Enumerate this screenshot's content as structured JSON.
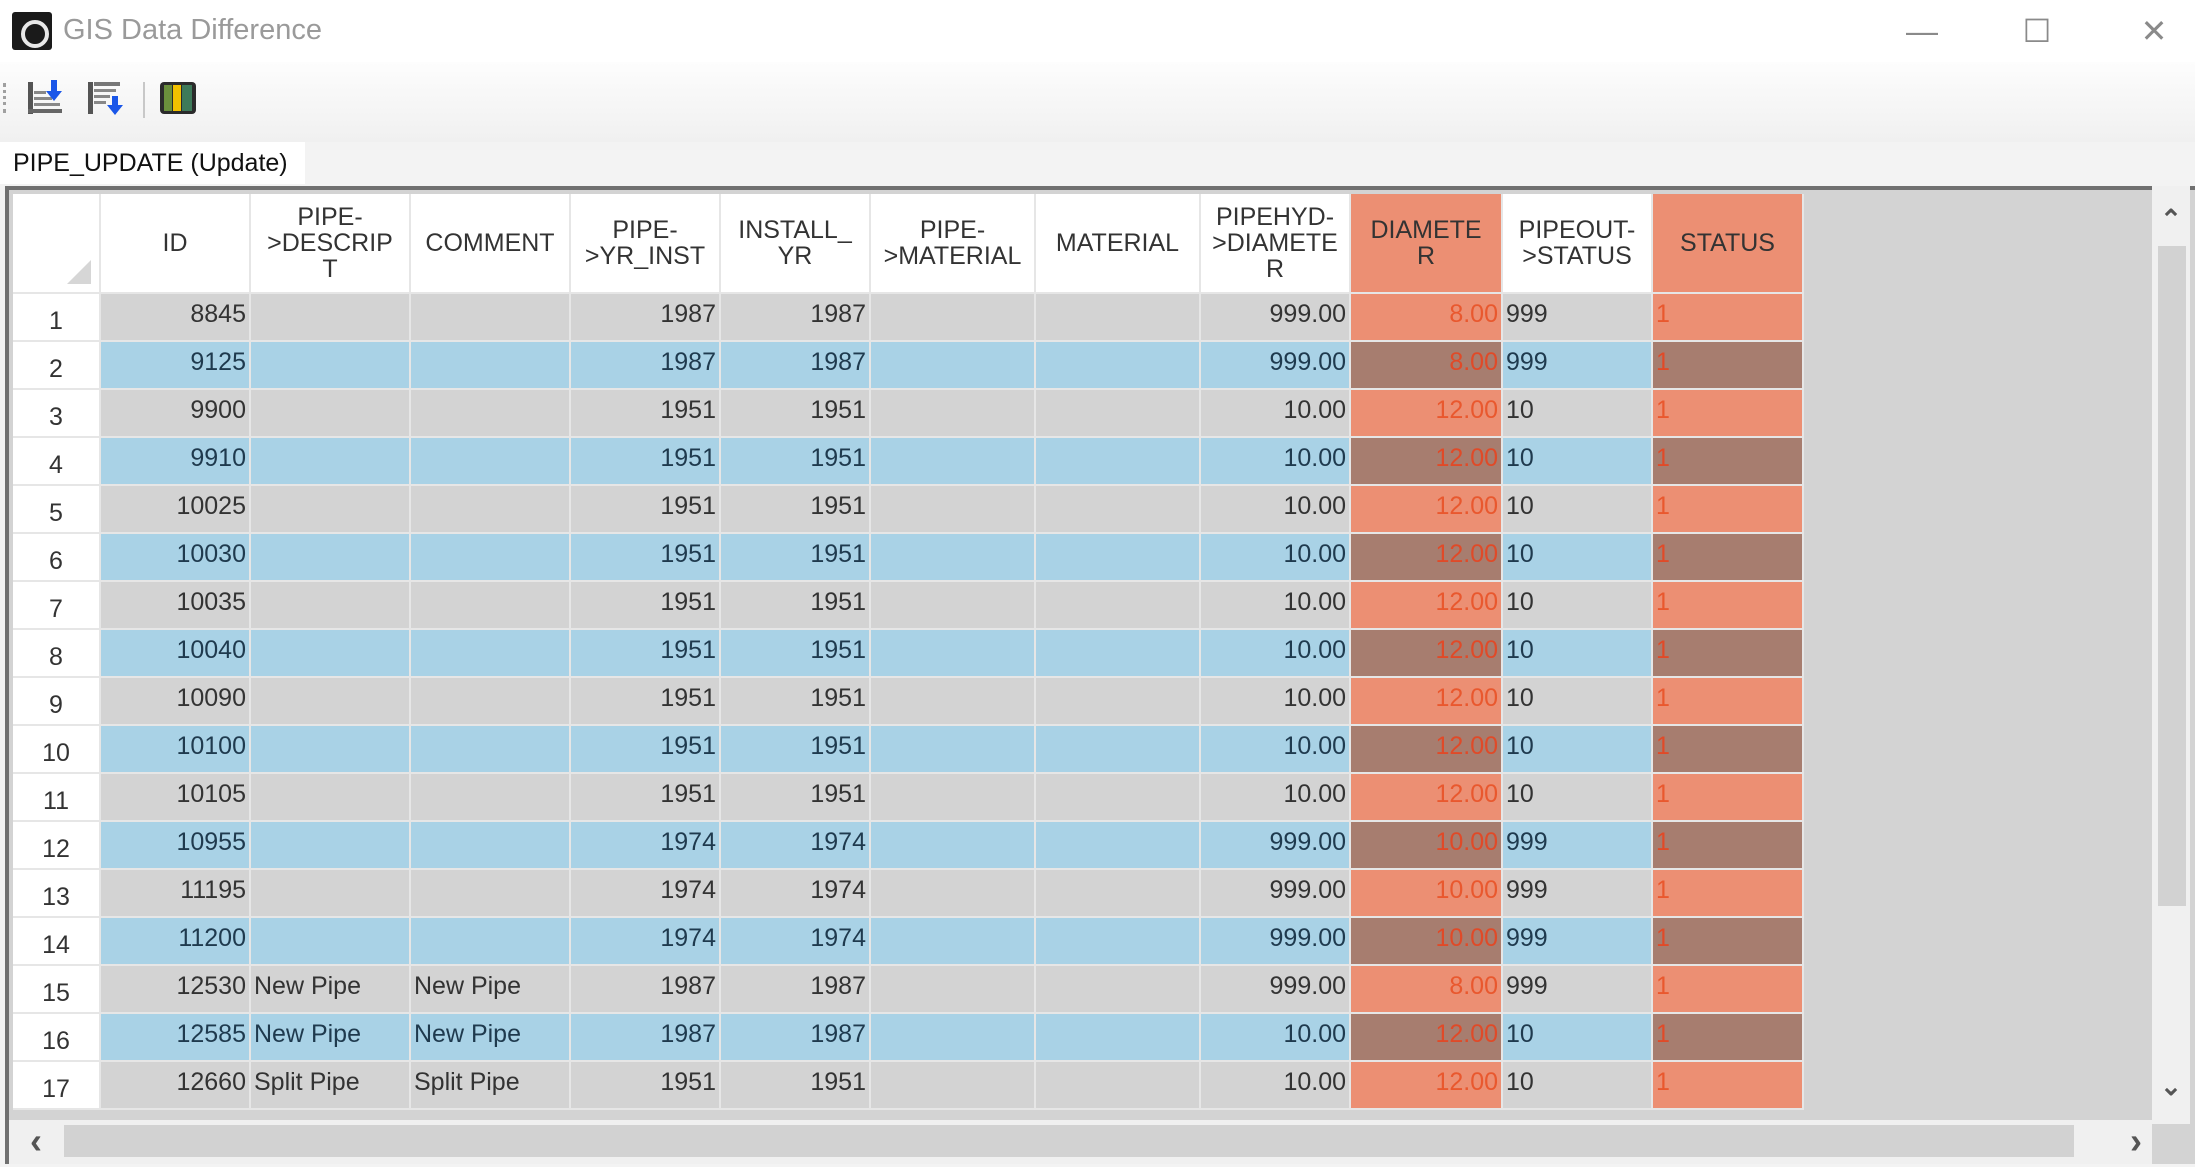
{
  "window": {
    "title": "GIS Data Difference",
    "minimize_icon": "minimize-icon",
    "maximize_icon": "maximize-icon",
    "close_icon": "close-icon",
    "minimize_glyph": "—",
    "maximize_glyph": "☐",
    "close_glyph": "✕"
  },
  "toolbar": {
    "buttons": [
      {
        "name": "export-down-icon"
      },
      {
        "name": "filter-down-icon"
      },
      {
        "name": "columns-color-icon"
      }
    ]
  },
  "tab": {
    "label": "PIPE_UPDATE (Update)"
  },
  "colors": {
    "diff_bg": "#ec8f73",
    "diff_bg_selected": "#a77d6f",
    "diff_text": "#e9582e",
    "row_alt_bg": "#a9d2e6"
  },
  "grid": {
    "columns": [
      {
        "key": "id",
        "label": "ID",
        "align": "num",
        "diff": false
      },
      {
        "key": "descrip",
        "label": "PIPE->DESCRIPT",
        "align": "left",
        "diff": false
      },
      {
        "key": "comment",
        "label": "COMMENT",
        "align": "left",
        "diff": false
      },
      {
        "key": "yr_inst",
        "label": "PIPE->YR_INST",
        "align": "num",
        "diff": false
      },
      {
        "key": "install_yr",
        "label": "INSTALL_YR",
        "align": "num",
        "diff": false
      },
      {
        "key": "pipe_material",
        "label": "PIPE->MATERIAL",
        "align": "left",
        "diff": false
      },
      {
        "key": "material",
        "label": "MATERIAL",
        "align": "left",
        "diff": false
      },
      {
        "key": "pipehyd_diameter",
        "label": "PIPEHYD->DIAMETER",
        "align": "num",
        "diff": false
      },
      {
        "key": "diameter",
        "label": "DIAMETER",
        "align": "num",
        "diff": true
      },
      {
        "key": "pipeout_status",
        "label": "PIPEOUT->STATUS",
        "align": "left",
        "diff": false
      },
      {
        "key": "status",
        "label": "STATUS",
        "align": "left",
        "diff": true
      }
    ],
    "header_lines": {
      "id": [
        "ID"
      ],
      "descrip": [
        "PIPE-",
        ">DESCRIP",
        "T"
      ],
      "comment": [
        "COMMENT"
      ],
      "yr_inst": [
        "PIPE-",
        ">YR_INST"
      ],
      "install_yr": [
        "INSTALL_",
        "YR"
      ],
      "pipe_material": [
        "PIPE-",
        ">MATERIAL"
      ],
      "material": [
        "MATERIAL"
      ],
      "pipehyd_diameter": [
        "PIPEHYD-",
        ">DIAMETE",
        "R"
      ],
      "diameter": [
        "DIAMETE",
        "R"
      ],
      "pipeout_status": [
        "PIPEOUT-",
        ">STATUS"
      ],
      "status": [
        "STATUS"
      ]
    },
    "rows": [
      {
        "n": "1",
        "id": "8845",
        "descrip": "",
        "comment": "",
        "yr_inst": "1987",
        "install_yr": "1987",
        "pipe_material": "",
        "material": "",
        "pipehyd_diameter": "999.00",
        "diameter": "8.00",
        "pipeout_status": "999",
        "status": "1"
      },
      {
        "n": "2",
        "id": "9125",
        "descrip": "",
        "comment": "",
        "yr_inst": "1987",
        "install_yr": "1987",
        "pipe_material": "",
        "material": "",
        "pipehyd_diameter": "999.00",
        "diameter": "8.00",
        "pipeout_status": "999",
        "status": "1"
      },
      {
        "n": "3",
        "id": "9900",
        "descrip": "",
        "comment": "",
        "yr_inst": "1951",
        "install_yr": "1951",
        "pipe_material": "",
        "material": "",
        "pipehyd_diameter": "10.00",
        "diameter": "12.00",
        "pipeout_status": "10",
        "status": "1"
      },
      {
        "n": "4",
        "id": "9910",
        "descrip": "",
        "comment": "",
        "yr_inst": "1951",
        "install_yr": "1951",
        "pipe_material": "",
        "material": "",
        "pipehyd_diameter": "10.00",
        "diameter": "12.00",
        "pipeout_status": "10",
        "status": "1"
      },
      {
        "n": "5",
        "id": "10025",
        "descrip": "",
        "comment": "",
        "yr_inst": "1951",
        "install_yr": "1951",
        "pipe_material": "",
        "material": "",
        "pipehyd_diameter": "10.00",
        "diameter": "12.00",
        "pipeout_status": "10",
        "status": "1"
      },
      {
        "n": "6",
        "id": "10030",
        "descrip": "",
        "comment": "",
        "yr_inst": "1951",
        "install_yr": "1951",
        "pipe_material": "",
        "material": "",
        "pipehyd_diameter": "10.00",
        "diameter": "12.00",
        "pipeout_status": "10",
        "status": "1"
      },
      {
        "n": "7",
        "id": "10035",
        "descrip": "",
        "comment": "",
        "yr_inst": "1951",
        "install_yr": "1951",
        "pipe_material": "",
        "material": "",
        "pipehyd_diameter": "10.00",
        "diameter": "12.00",
        "pipeout_status": "10",
        "status": "1"
      },
      {
        "n": "8",
        "id": "10040",
        "descrip": "",
        "comment": "",
        "yr_inst": "1951",
        "install_yr": "1951",
        "pipe_material": "",
        "material": "",
        "pipehyd_diameter": "10.00",
        "diameter": "12.00",
        "pipeout_status": "10",
        "status": "1"
      },
      {
        "n": "9",
        "id": "10090",
        "descrip": "",
        "comment": "",
        "yr_inst": "1951",
        "install_yr": "1951",
        "pipe_material": "",
        "material": "",
        "pipehyd_diameter": "10.00",
        "diameter": "12.00",
        "pipeout_status": "10",
        "status": "1"
      },
      {
        "n": "10",
        "id": "10100",
        "descrip": "",
        "comment": "",
        "yr_inst": "1951",
        "install_yr": "1951",
        "pipe_material": "",
        "material": "",
        "pipehyd_diameter": "10.00",
        "diameter": "12.00",
        "pipeout_status": "10",
        "status": "1"
      },
      {
        "n": "11",
        "id": "10105",
        "descrip": "",
        "comment": "",
        "yr_inst": "1951",
        "install_yr": "1951",
        "pipe_material": "",
        "material": "",
        "pipehyd_diameter": "10.00",
        "diameter": "12.00",
        "pipeout_status": "10",
        "status": "1"
      },
      {
        "n": "12",
        "id": "10955",
        "descrip": "",
        "comment": "",
        "yr_inst": "1974",
        "install_yr": "1974",
        "pipe_material": "",
        "material": "",
        "pipehyd_diameter": "999.00",
        "diameter": "10.00",
        "pipeout_status": "999",
        "status": "1"
      },
      {
        "n": "13",
        "id": "11195",
        "descrip": "",
        "comment": "",
        "yr_inst": "1974",
        "install_yr": "1974",
        "pipe_material": "",
        "material": "",
        "pipehyd_diameter": "999.00",
        "diameter": "10.00",
        "pipeout_status": "999",
        "status": "1"
      },
      {
        "n": "14",
        "id": "11200",
        "descrip": "",
        "comment": "",
        "yr_inst": "1974",
        "install_yr": "1974",
        "pipe_material": "",
        "material": "",
        "pipehyd_diameter": "999.00",
        "diameter": "10.00",
        "pipeout_status": "999",
        "status": "1"
      },
      {
        "n": "15",
        "id": "12530",
        "descrip": "New Pipe",
        "comment": "New Pipe",
        "yr_inst": "1987",
        "install_yr": "1987",
        "pipe_material": "",
        "material": "",
        "pipehyd_diameter": "999.00",
        "diameter": "8.00",
        "pipeout_status": "999",
        "status": "1"
      },
      {
        "n": "16",
        "id": "12585",
        "descrip": "New Pipe",
        "comment": "New Pipe",
        "yr_inst": "1987",
        "install_yr": "1987",
        "pipe_material": "",
        "material": "",
        "pipehyd_diameter": "10.00",
        "diameter": "12.00",
        "pipeout_status": "10",
        "status": "1"
      },
      {
        "n": "17",
        "id": "12660",
        "descrip": "Split Pipe",
        "comment": "Split Pipe",
        "yr_inst": "1951",
        "install_yr": "1951",
        "pipe_material": "",
        "material": "",
        "pipehyd_diameter": "10.00",
        "diameter": "12.00",
        "pipeout_status": "10",
        "status": "1"
      }
    ]
  },
  "scrollbars": {
    "up_glyph": "⌃",
    "down_glyph": "⌄",
    "left_glyph": "‹",
    "right_glyph": "›"
  }
}
